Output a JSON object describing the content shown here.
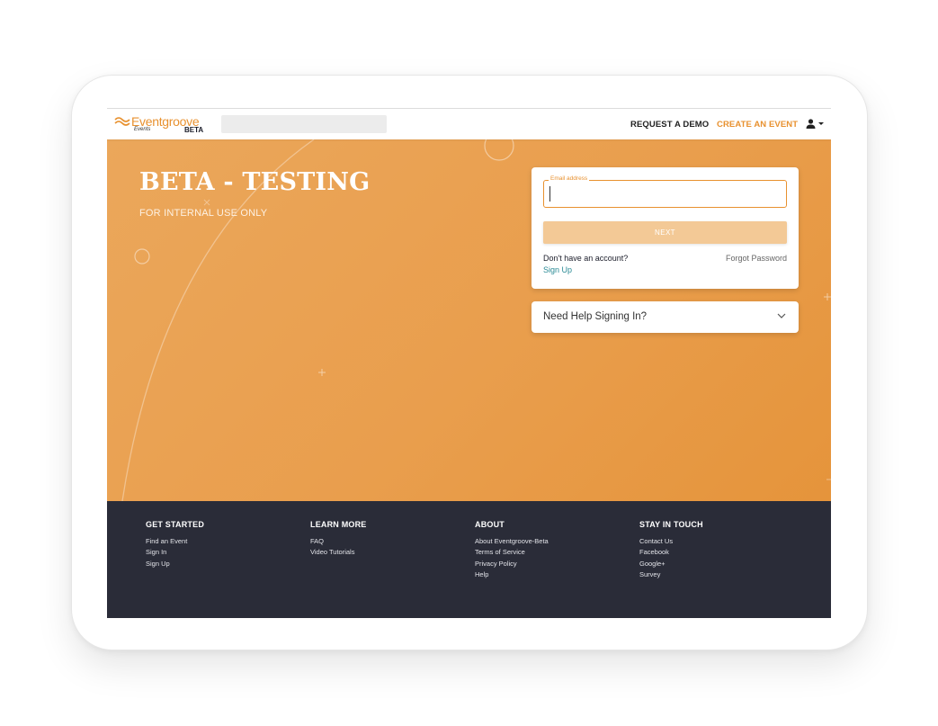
{
  "nav": {
    "logo_name": "Eventgroove",
    "logo_sub": "Events",
    "logo_badge": "BETA",
    "request_demo": "REQUEST A DEMO",
    "create_event": "CREATE AN EVENT",
    "brand_color": "#e8912f"
  },
  "hero": {
    "title": "BETA - TESTING",
    "subtitle": "FOR INTERNAL USE ONLY"
  },
  "login": {
    "email_label": "Email address",
    "email_value": "",
    "next_label": "NEXT",
    "no_account": "Don't have an account?",
    "signup": "Sign Up",
    "forgot": "Forgot Password"
  },
  "help": {
    "label": "Need Help Signing In?"
  },
  "footer": {
    "columns": [
      {
        "heading": "GET STARTED",
        "items": [
          "Find an Event",
          "Sign In",
          "Sign Up"
        ]
      },
      {
        "heading": "LEARN MORE",
        "items": [
          "FAQ",
          "Video Tutorials"
        ]
      },
      {
        "heading": "ABOUT",
        "items": [
          "About Eventgroove-Beta",
          "Terms of Service",
          "Privacy Policy",
          "Help"
        ]
      },
      {
        "heading": "STAY IN TOUCH",
        "items": [
          "Contact Us",
          "Facebook",
          "Google+",
          "Survey"
        ]
      }
    ]
  }
}
